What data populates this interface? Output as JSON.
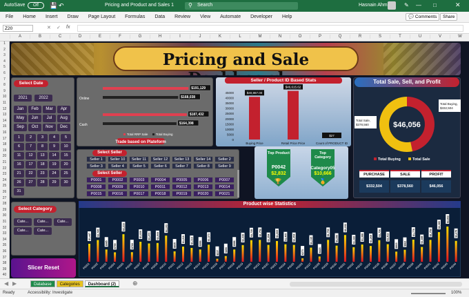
{
  "titlebar": {
    "autosave": "AutoSave",
    "toggle": "Off",
    "file": "Pricing and Product and Sales 1",
    "search": "Search",
    "user": "Hasnain Ahmad"
  },
  "ribbon": {
    "tabs": [
      "File",
      "Home",
      "Insert",
      "Draw",
      "Page Layout",
      "Formulas",
      "Data",
      "Review",
      "View",
      "Automate",
      "Developer",
      "Help"
    ],
    "comments": "Comments",
    "share": "Share"
  },
  "formula": {
    "cell": "Z20",
    "fx": "fx"
  },
  "columns": [
    "A",
    "B",
    "C",
    "D",
    "E",
    "F",
    "G",
    "H",
    "I",
    "J",
    "K",
    "L",
    "M",
    "N",
    "O",
    "P",
    "Q",
    "R",
    "S",
    "T",
    "U",
    "V",
    "W"
  ],
  "rows": [
    "1",
    "2",
    "3",
    "4",
    "5",
    "6",
    "7",
    "8",
    "9",
    "10",
    "11",
    "12",
    "13",
    "14",
    "15",
    "16",
    "17",
    "18",
    "19",
    "20",
    "21",
    "22",
    "23",
    "24",
    "25",
    "26",
    "27",
    "28",
    "29",
    "30",
    "31",
    "32",
    "33",
    "34",
    "35",
    "36",
    "37",
    "38",
    "39",
    "40"
  ],
  "dashboard": {
    "title": "Pricing and Sale Dashboard",
    "select_date": "Select Date",
    "years": [
      "2021",
      "2022"
    ],
    "months": [
      "Jan",
      "Feb",
      "Mar",
      "Apr",
      "May",
      "Jun",
      "Jul",
      "Aug",
      "Sep",
      "Oct",
      "Nov",
      "Dec"
    ],
    "days": [
      "1",
      "2",
      "3",
      "4",
      "5",
      "6",
      "7",
      "8",
      "9",
      "10",
      "11",
      "12",
      "13",
      "14",
      "15",
      "16",
      "17",
      "18",
      "19",
      "20",
      "21",
      "22",
      "23",
      "24",
      "25",
      "26",
      "27",
      "28",
      "29",
      "30",
      "31"
    ],
    "select_category": "Select Category",
    "categories": [
      "Cate...",
      "Cate...",
      "Cate...",
      "Cate...",
      "Cate..."
    ],
    "slicer_reset": "Slicer Reset",
    "platform": {
      "title": "Trade based on Plateform",
      "rows": [
        "Online",
        "Cash"
      ],
      "labels": [
        "$191,129",
        "$168,038",
        "$187,432",
        "$164,398"
      ],
      "legend": [
        "Total RRP Sale",
        "Total Buying"
      ]
    },
    "seller_stats": {
      "title": "Seller / Product ID Based Stats",
      "yticks": [
        "45000",
        "40000",
        "35000",
        "30000",
        "25000",
        "20000",
        "15000",
        "10000",
        "5000",
        "0"
      ],
      "cats": [
        "Buying Price",
        "Retail Price Price",
        "Count of PRODUCT ID"
      ],
      "labels": [
        "$40,867.00",
        "$46,615.62",
        "$27"
      ]
    },
    "select_seller": "Select Seller",
    "sellers": [
      "Seller 1",
      "Seller 10",
      "Seller 11",
      "Seller 12",
      "Seller 13",
      "Seller 14",
      "Seller 2",
      "Seller 3",
      "Seller 4",
      "Seller 5",
      "Seller 6",
      "Seller 7",
      "Seller 8",
      "Seller 9"
    ],
    "select_product": "Select Seller",
    "products": [
      "P0001",
      "P0002",
      "P0003",
      "P0004",
      "P0005",
      "P0006",
      "P0007",
      "P0008",
      "P0009",
      "P0010",
      "P0011",
      "P0012",
      "P0013",
      "P0014",
      "P0015",
      "P0016",
      "P0017",
      "P0018",
      "P0019",
      "P0020",
      "P0021"
    ],
    "top_product": {
      "title": "Top Product",
      "id": "P0042",
      "value": "$2,832"
    },
    "top_category": {
      "title": "Top Category",
      "id": "Category05",
      "value": "$10,666"
    },
    "donut": {
      "title": "Total Sale, Sell, and Profit",
      "center": "$46,056",
      "left_label": "Total Sale, $378,560",
      "right_label": "Total Buying, $332,504",
      "legend": [
        "Total Buying",
        "Total Sale"
      ]
    },
    "summary": {
      "headers": [
        "PURCHASE",
        "SALE",
        "PROFIT"
      ],
      "values": [
        "$332,504",
        "$378,560",
        "$46,056"
      ]
    },
    "product_stats": {
      "title": "Product wise Statistics"
    }
  },
  "chart_data": [
    {
      "type": "bar",
      "title": "Trade based on Plateform",
      "categories": [
        "Online",
        "Cash"
      ],
      "series": [
        {
          "name": "Total RRP Sale",
          "values": [
            191129,
            187432
          ]
        },
        {
          "name": "Total Buying",
          "values": [
            168038,
            164398
          ]
        }
      ]
    },
    {
      "type": "bar",
      "title": "Seller / Product ID Based Stats",
      "categories": [
        "Buying Price",
        "Retail Price Price",
        "Count of PRODUCT ID"
      ],
      "values": [
        40867,
        46615.62,
        27
      ],
      "ylim": [
        0,
        45000
      ]
    },
    {
      "type": "pie",
      "title": "Total Sale, Sell, and Profit",
      "categories": [
        "Total Buying",
        "Total Sale"
      ],
      "values": [
        332504,
        378560
      ]
    },
    {
      "type": "bar",
      "title": "Product wise Statistics",
      "categories": [
        "P0001",
        "P0002",
        "P0003",
        "P0004",
        "P0005",
        "P0006",
        "P0007",
        "P0008",
        "P0009",
        "P0010",
        "P0011",
        "P0012",
        "P0013",
        "P0014",
        "P0015",
        "P0016",
        "P0017",
        "P0018",
        "P0019",
        "P0020",
        "P0021",
        "P0022",
        "P0023",
        "P0024",
        "P0025",
        "P0026",
        "P0027",
        "P0028",
        "P0029",
        "P0030",
        "P0031",
        "P0032",
        "P0033",
        "P0034",
        "P0035",
        "P0036",
        "P0037",
        "P0038",
        "P0039",
        "P0040",
        "P0041",
        "P0042",
        "P0043",
        "P0044"
      ],
      "values": [
        1447,
        1745,
        985,
        759,
        2216,
        769,
        1609,
        1472,
        1509,
        2103,
        835,
        1219,
        1113,
        986,
        1373,
        237,
        456,
        986,
        1339,
        1735,
        1759,
        1354,
        1669,
        1405,
        1354,
        273,
        1135,
        423,
        1759,
        1296,
        2152,
        1169,
        1388,
        1269,
        1736,
        1412,
        815,
        962,
        1779,
        1188,
        1759,
        2385,
        2832,
        1679
      ]
    }
  ],
  "colors": {
    "accent": "#c3212e",
    "yellow": "#f0c010",
    "excel_green": "#1e6e40",
    "dark_bg": "#0f1423"
  }
}
